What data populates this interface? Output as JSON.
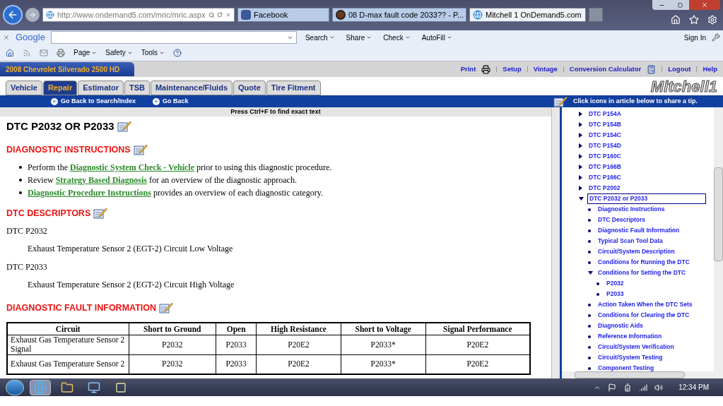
{
  "browser": {
    "address": "http://www.ondemand5.com/mric/mric.aspx",
    "tabs": [
      {
        "title": "Facebook",
        "selected": false,
        "kind": "facebook"
      },
      {
        "title": "08 D-max fault code 2033?? - P...",
        "selected": false,
        "kind": "forum"
      },
      {
        "title": "Mitchell 1 OnDemand5.com",
        "selected": true,
        "kind": "ie"
      }
    ],
    "google_toolbar": {
      "logo": "Google",
      "buttons": [
        "Search",
        "Share",
        "Check",
        "AutoFill"
      ],
      "sign_in": "Sign In"
    },
    "command_bar": [
      "Page",
      "Safety",
      "Tools"
    ]
  },
  "site": {
    "vehicle": "2008 Chevrolet Silverado 2500 HD",
    "links": [
      "Print",
      "Setup",
      "Vintage",
      "Conversion Calculator",
      "Logout",
      "Help"
    ],
    "tabs": [
      {
        "label": "Vehicle",
        "selected": false
      },
      {
        "label": "Repair",
        "selected": true
      },
      {
        "label": "Estimator",
        "selected": false
      },
      {
        "label": "TSB",
        "selected": false
      },
      {
        "label": "Maintenance/Fluids",
        "selected": false
      },
      {
        "label": "Quote",
        "selected": false
      },
      {
        "label": "Tire Fitment",
        "selected": false
      }
    ],
    "logo": "Mitchell1",
    "nav": [
      "Go Back to Search/Index",
      "Go Back"
    ],
    "tip": "Click icons in article below to share a tip.",
    "hint": "Press Ctrl+F to find exact text"
  },
  "article": {
    "title": "DTC P2032 OR P2033",
    "sections": [
      {
        "heading": "DIAGNOSTIC INSTRUCTIONS",
        "kind": "bullets",
        "bullets": [
          [
            {
              "text": "Perform the "
            },
            {
              "link": "Diagnostic System Check - Vehicle"
            },
            {
              "text": " prior to using this diagnostic procedure."
            }
          ],
          [
            {
              "text": "Review "
            },
            {
              "link": "Strategy Based Diagnosis"
            },
            {
              "text": " for an overview of the diagnostic approach."
            }
          ],
          [
            {
              "link": "Diagnostic Procedure Instructions"
            },
            {
              "text": " provides an overview of each diagnostic category."
            }
          ]
        ]
      },
      {
        "heading": "DTC DESCRIPTORS",
        "kind": "descriptors",
        "descriptors": [
          {
            "code": "DTC P2032",
            "text": "Exhaust Temperature Sensor 2 (EGT-2) Circuit Low Voltage"
          },
          {
            "code": "DTC P2033",
            "text": "Exhaust Temperature Sensor 2 (EGT-2) Circuit High Voltage"
          }
        ]
      },
      {
        "heading": "DIAGNOSTIC FAULT INFORMATION",
        "kind": "table",
        "table": {
          "columns": [
            "Circuit",
            "Short to Ground",
            "Open",
            "High Resistance",
            "Short to Voltage",
            "Signal Performance"
          ],
          "rows": [
            [
              "Exhaust Gas Temperature Sensor 2 Signal",
              "P2032",
              "P2033",
              "P20E2",
              "P2033*",
              "P20E2"
            ],
            [
              "Exhaust Gas Temperature Sensor 2",
              "P2032",
              "P2033",
              "P20E2",
              "P2033*",
              "P20E2"
            ]
          ]
        }
      }
    ]
  },
  "tree": [
    {
      "label": "DTC P154A",
      "expanded": false,
      "selected": false
    },
    {
      "label": "DTC P154B",
      "expanded": false,
      "selected": false
    },
    {
      "label": "DTC P154C",
      "expanded": false,
      "selected": false
    },
    {
      "label": "DTC P154D",
      "expanded": false,
      "selected": false
    },
    {
      "label": "DTC P160C",
      "expanded": false,
      "selected": false
    },
    {
      "label": "DTC P166B",
      "expanded": false,
      "selected": false
    },
    {
      "label": "DTC P166C",
      "expanded": false,
      "selected": false
    },
    {
      "label": "DTC P2002",
      "expanded": false,
      "selected": false
    },
    {
      "label": "DTC P2032 or P2033",
      "expanded": true,
      "selected": true,
      "children": [
        {
          "label": "Diagnostic Instructions",
          "selected": false
        },
        {
          "label": "DTC Descriptors",
          "selected": false
        },
        {
          "label": "Diagnostic Fault Information",
          "selected": false
        },
        {
          "label": "Typical Scan Tool Data",
          "selected": false
        },
        {
          "label": "Circuit/System Description",
          "selected": false
        },
        {
          "label": "Conditions for Running the DTC",
          "selected": false
        },
        {
          "label": "Conditions for Setting the DTC",
          "expanded": true,
          "selected": false,
          "children": [
            {
              "label": "P2032",
              "selected": false
            },
            {
              "label": "P2033",
              "selected": false
            }
          ]
        },
        {
          "label": "Action Taken When the DTC Sets",
          "selected": false
        },
        {
          "label": "Conditions for Clearing the DTC",
          "selected": false
        },
        {
          "label": "Diagnostic Aids",
          "selected": false
        },
        {
          "label": "Reference Information",
          "selected": false
        },
        {
          "label": "Circuit/System Verification",
          "selected": false
        },
        {
          "label": "Circuit/System Testing",
          "selected": false
        },
        {
          "label": "Component Testing",
          "selected": false
        }
      ]
    }
  ],
  "taskbar": {
    "apps": [
      {
        "kind": "ie",
        "active": true
      },
      {
        "kind": "folder",
        "active": false
      },
      {
        "kind": "network",
        "active": false
      },
      {
        "kind": "windows",
        "active": false
      }
    ],
    "clock": "12:34 PM"
  }
}
